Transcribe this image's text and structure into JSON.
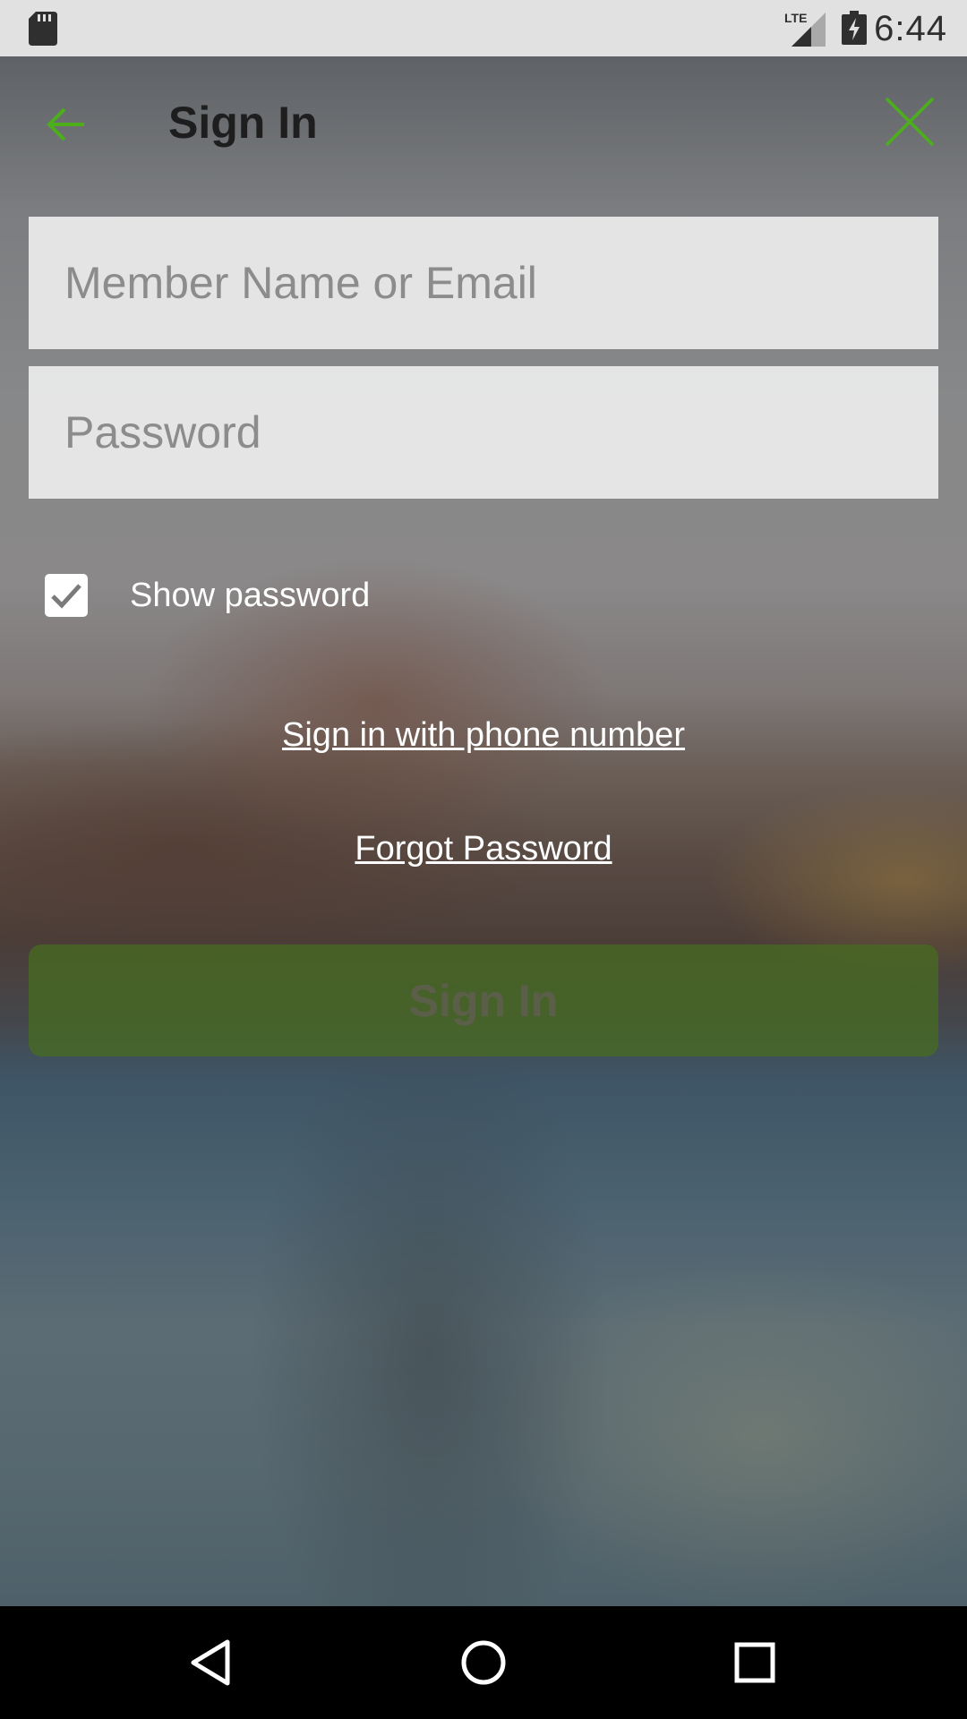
{
  "status_bar": {
    "time": "6:44",
    "network": "LTE",
    "icons": [
      "sd-card-icon",
      "lte-signal-icon",
      "battery-charging-icon"
    ]
  },
  "header": {
    "title": "Sign In",
    "back_icon": "arrow-left-icon",
    "close_icon": "close-icon",
    "accent_color": "#4caf1a"
  },
  "form": {
    "member_field": {
      "placeholder": "Member Name or Email",
      "value": ""
    },
    "password_field": {
      "placeholder": "Password",
      "value": ""
    },
    "show_password": {
      "label": "Show password",
      "checked": true
    },
    "phone_link": "Sign in with phone number",
    "forgot_link": "Forgot Password",
    "submit_label": "Sign In"
  },
  "nav_bar": {
    "icons": [
      "nav-back-icon",
      "nav-home-icon",
      "nav-recents-icon"
    ]
  }
}
